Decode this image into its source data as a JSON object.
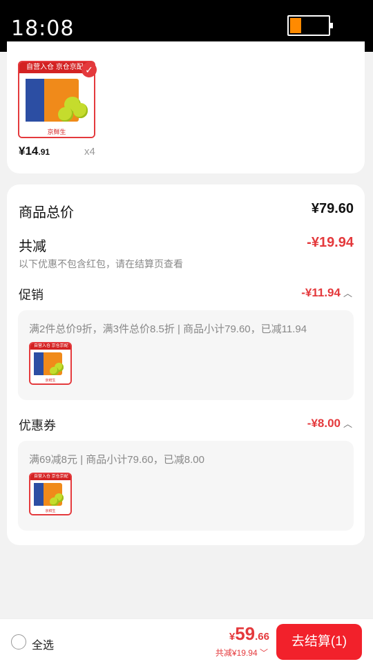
{
  "status": {
    "time": "18:08",
    "battery_level": 0.28
  },
  "product": {
    "badge_text": "自营入仓 京仓京配",
    "brand_text": "京鲜生",
    "price_symbol": "¥",
    "price_int": "14",
    "price_dec": ".91",
    "quantity": "x4"
  },
  "summary": {
    "total_label": "商品总价",
    "total_value": "¥79.60",
    "discount_label": "共减",
    "discount_value": "-¥19.94",
    "note": "以下优惠不包含红包，请在结算页查看",
    "promo": {
      "label": "促销",
      "value": "-¥11.94",
      "desc": "满2件总价9折，满3件总价8.5折 | 商品小计79.60，已减11.94"
    },
    "coupon": {
      "label": "优惠券",
      "value": "-¥8.00",
      "desc": "满69减8元 | 商品小计79.60，已减8.00"
    }
  },
  "bottom": {
    "select_all": "全选",
    "price_symbol": "¥",
    "price_int": "59",
    "price_dec": ".66",
    "saved": "共减¥19.94",
    "checkout": "去结算(1)"
  },
  "colors": {
    "accent": "#e4393c",
    "button": "#f2212b"
  }
}
